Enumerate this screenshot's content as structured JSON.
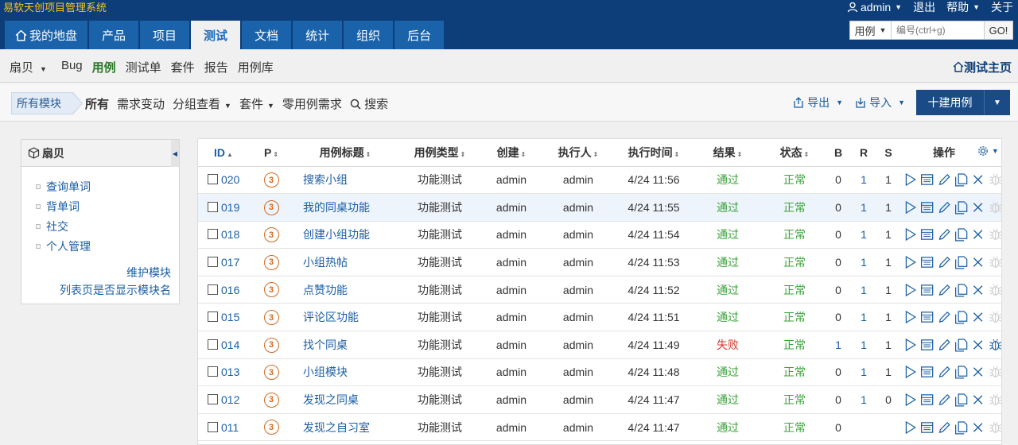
{
  "header": {
    "app_title": "易软天创项目管理系统",
    "user": "admin",
    "logout": "退出",
    "help": "帮助",
    "about": "关于",
    "nav_tabs": [
      {
        "label": "我的地盘",
        "icon": "home-icon",
        "active": false
      },
      {
        "label": "产品",
        "active": false
      },
      {
        "label": "项目",
        "active": false
      },
      {
        "label": "测试",
        "active": true
      },
      {
        "label": "文档",
        "active": false
      },
      {
        "label": "统计",
        "active": false
      },
      {
        "label": "组织",
        "active": false
      },
      {
        "label": "后台",
        "active": false
      }
    ],
    "search": {
      "type": "用例",
      "placeholder": "编号(ctrl+g)",
      "go": "GO!"
    }
  },
  "subnav": {
    "product": "扇贝",
    "items": [
      "Bug",
      "用例",
      "测试单",
      "套件",
      "报告",
      "用例库"
    ],
    "active": "用例",
    "home_link": "测试主页"
  },
  "toolbar": {
    "crumb": "所有模块",
    "filters": [
      "所有",
      "需求变动",
      "分组查看",
      "套件",
      "零用例需求",
      "搜索"
    ],
    "export": "导出",
    "import": "导入",
    "create": "十建用例"
  },
  "sidebar": {
    "title": "扇贝",
    "modules": [
      "查询单词",
      "背单词",
      "社交",
      "个人管理"
    ],
    "maintain": "维护模块",
    "show_module": "列表页是否显示模块名"
  },
  "table": {
    "headers": {
      "id": "ID",
      "pri": "P",
      "title": "用例标题",
      "type": "用例类型",
      "creator": "创建",
      "executor": "执行人",
      "exec_time": "执行时间",
      "result": "结果",
      "status": "状态",
      "b": "B",
      "r": "R",
      "s": "S",
      "actions": "操作"
    },
    "rows": [
      {
        "id": "020",
        "pri": "3",
        "title": "搜索小组",
        "type": "功能测试",
        "creator": "admin",
        "executor": "admin",
        "time": "4/24 11:56",
        "result": "通过",
        "status": "正常",
        "b": "0",
        "r": "1",
        "s": "1"
      },
      {
        "id": "019",
        "pri": "3",
        "title": "我的同桌功能",
        "type": "功能测试",
        "creator": "admin",
        "executor": "admin",
        "time": "4/24 11:55",
        "result": "通过",
        "status": "正常",
        "b": "0",
        "r": "1",
        "s": "1"
      },
      {
        "id": "018",
        "pri": "3",
        "title": "创建小组功能",
        "type": "功能测试",
        "creator": "admin",
        "executor": "admin",
        "time": "4/24 11:54",
        "result": "通过",
        "status": "正常",
        "b": "0",
        "r": "1",
        "s": "1"
      },
      {
        "id": "017",
        "pri": "3",
        "title": "小组热帖",
        "type": "功能测试",
        "creator": "admin",
        "executor": "admin",
        "time": "4/24 11:53",
        "result": "通过",
        "status": "正常",
        "b": "0",
        "r": "1",
        "s": "1"
      },
      {
        "id": "016",
        "pri": "3",
        "title": "点赞功能",
        "type": "功能测试",
        "creator": "admin",
        "executor": "admin",
        "time": "4/24 11:52",
        "result": "通过",
        "status": "正常",
        "b": "0",
        "r": "1",
        "s": "1"
      },
      {
        "id": "015",
        "pri": "3",
        "title": "评论区功能",
        "type": "功能测试",
        "creator": "admin",
        "executor": "admin",
        "time": "4/24 11:51",
        "result": "通过",
        "status": "正常",
        "b": "0",
        "r": "1",
        "s": "1"
      },
      {
        "id": "014",
        "pri": "3",
        "title": "找个同桌",
        "type": "功能测试",
        "creator": "admin",
        "executor": "admin",
        "time": "4/24 11:49",
        "result": "失败",
        "status": "正常",
        "b": "1",
        "r": "1",
        "s": "1"
      },
      {
        "id": "013",
        "pri": "3",
        "title": "小组模块",
        "type": "功能测试",
        "creator": "admin",
        "executor": "admin",
        "time": "4/24 11:48",
        "result": "通过",
        "status": "正常",
        "b": "0",
        "r": "1",
        "s": "1"
      },
      {
        "id": "012",
        "pri": "3",
        "title": "发现之同桌",
        "type": "功能测试",
        "creator": "admin",
        "executor": "admin",
        "time": "4/24 11:47",
        "result": "通过",
        "status": "正常",
        "b": "0",
        "r": "1",
        "s": "0"
      },
      {
        "id": "011",
        "pri": "3",
        "title": "发现之自习室",
        "type": "功能测试",
        "creator": "admin",
        "executor": "admin",
        "time": "4/24 11:47",
        "result": "通过",
        "status": "正常",
        "b": "0",
        "r": "",
        "s": ""
      }
    ],
    "highlight_row": "019"
  },
  "colors": {
    "brand": "#0d3e79",
    "nav_tab": "#1a62a9",
    "pass": "#3aa33a",
    "fail": "#d43a2c",
    "link": "#1a5ea6"
  }
}
